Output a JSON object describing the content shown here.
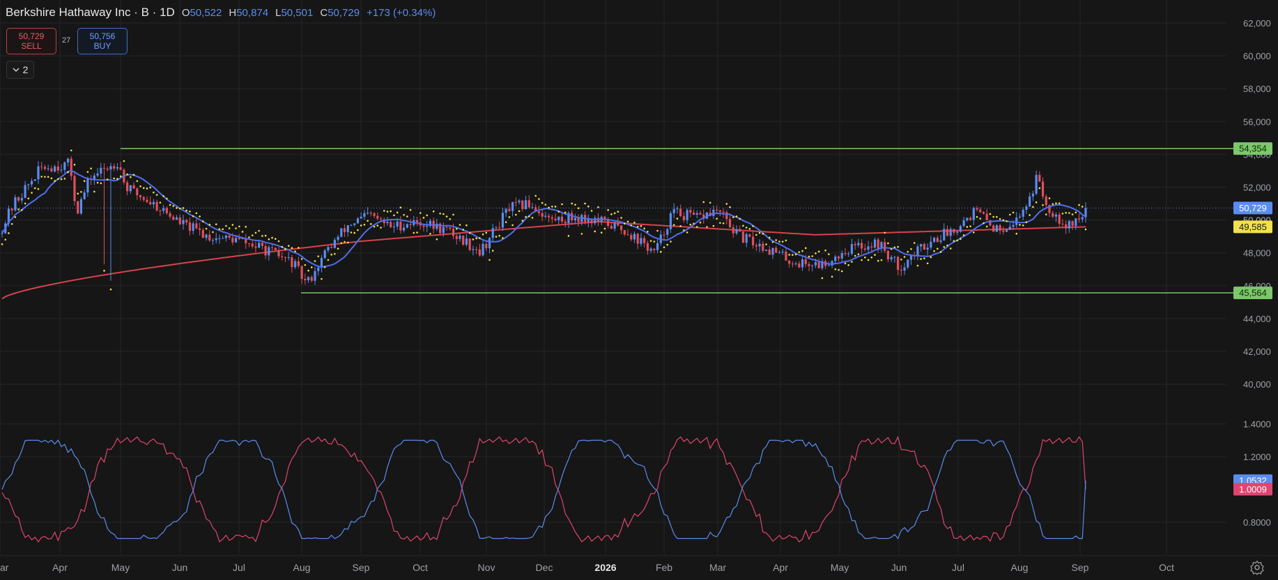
{
  "header": {
    "title": "Berkshire Hathaway Inc · B · 1D",
    "open_label": "O",
    "open": "50,522",
    "high_label": "H",
    "high": "50,874",
    "low_label": "L",
    "low": "50,501",
    "close_label": "C",
    "close": "50,729",
    "change": "+173 (+0.34%)"
  },
  "trade": {
    "sell_price": "50,729",
    "sell_label": "SELL",
    "spread": "27",
    "buy_price": "50,756",
    "buy_label": "BUY"
  },
  "indicators_toggle": {
    "count": "2"
  },
  "colors": {
    "background": "#161616",
    "grid": "#262626",
    "up": "#5b8def",
    "down": "#e0505c",
    "ma_fast": "#4f6ff0",
    "ma_slow": "#d9424c",
    "sar": "#f2e14a",
    "level": "#7cc86a",
    "osc_a": "#5b8def",
    "osc_b": "#e0456f"
  },
  "price_axis": {
    "ticks": [
      "62,000",
      "60,000",
      "58,000",
      "56,000",
      "54,000",
      "52,000",
      "50,000",
      "48,000",
      "46,000",
      "44,000",
      "42,000",
      "40,000"
    ],
    "tick_values": [
      62000,
      60000,
      58000,
      56000,
      54000,
      52000,
      50000,
      48000,
      46000,
      44000,
      42000,
      40000
    ]
  },
  "osc_axis": {
    "ticks": [
      "1.4000",
      "1.2000",
      "0.8000"
    ],
    "tick_values": [
      1.4,
      1.2,
      0.8
    ]
  },
  "time_axis": {
    "labels": [
      "ar",
      "Apr",
      "May",
      "Jun",
      "Jul",
      "Aug",
      "Sep",
      "Oct",
      "Nov",
      "Dec",
      "2026",
      "Feb",
      "Mar",
      "Apr",
      "May",
      "Jun",
      "Jul",
      "Aug",
      "Sep",
      "Oct"
    ],
    "bold": [
      false,
      false,
      false,
      false,
      false,
      false,
      false,
      false,
      false,
      false,
      true,
      false,
      false,
      false,
      false,
      false,
      false,
      false,
      false,
      false
    ]
  },
  "levels": {
    "upper": 54354,
    "lower": 45564,
    "upper_label": "54,354",
    "lower_label": "45,564"
  },
  "badges": {
    "last": "50,729",
    "hidden": "50,000",
    "ma": "49,585",
    "osc_a": "1.0532",
    "osc_b": "1.0009"
  },
  "chart_data": {
    "type": "candlestick",
    "symbol": "Berkshire Hathaway Inc · B · 1D",
    "price_range": [
      38500,
      63000
    ],
    "last_close": 50729,
    "ma_level": 49585,
    "support_level": 45564,
    "resistance_level": 54354,
    "oscillator_values": {
      "series_a": 1.0532,
      "series_b": 1.0009
    }
  }
}
